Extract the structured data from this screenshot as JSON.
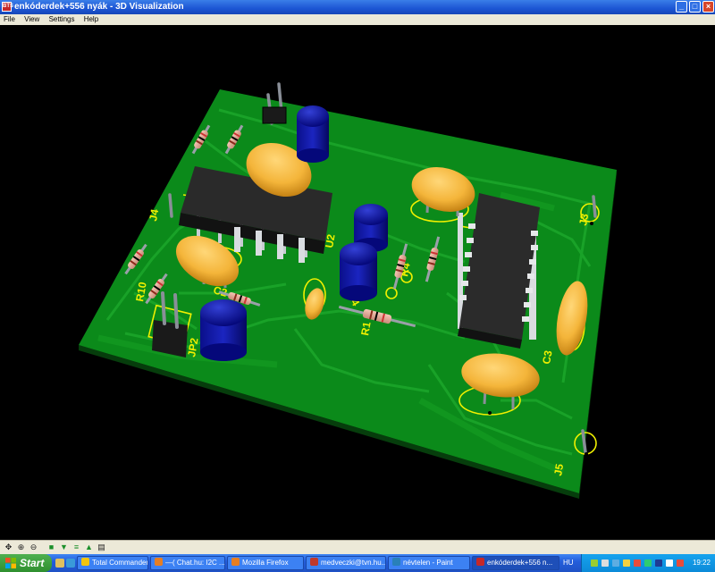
{
  "window": {
    "app_icon_text": "BTS",
    "title": "enkóderdek+556 nyák - 3D Visualization",
    "controls": {
      "minimize": "_",
      "maximize": "□",
      "close": "×"
    }
  },
  "menu": [
    "File",
    "View",
    "Settings",
    "Help"
  ],
  "viewer": {
    "background": "#000000",
    "board_color": "#0b8a1a",
    "silkscreen_color": "#f0f000",
    "labels": [
      "J3",
      "J5",
      "C2",
      "C3",
      "C4",
      "U2",
      "U3",
      "R1",
      "R4",
      "R10",
      "JP2",
      "J4"
    ],
    "components": [
      "two 14-pin DIP ICs",
      "blue electrolytic capacitors",
      "yellow ceramic capacitors",
      "resistors",
      "jumper header"
    ]
  },
  "toolstrip": {
    "icons": [
      "pan-icon",
      "zoom-in-icon",
      "zoom-out-icon",
      "board-color-icon",
      "top-view-icon",
      "layer-icon",
      "component-icon",
      "settings-icon"
    ]
  },
  "taskbar": {
    "start_label": "Start",
    "tasks": [
      {
        "label": "Total Commander ...",
        "icon_color": "#f1c40f",
        "active": false
      },
      {
        "label": "—( Chat.hu: I2C ...",
        "icon_color": "#e67e22",
        "active": false
      },
      {
        "label": "Mozilla Firefox",
        "icon_color": "#e67e22",
        "active": false
      },
      {
        "label": "medveczki@tvn.hu...",
        "icon_color": "#c0392b",
        "active": false
      },
      {
        "label": "névtelen - Paint",
        "icon_color": "#2980b9",
        "active": false
      },
      {
        "label": "enkóderdek+556 n...",
        "icon_color": "#c62828",
        "active": true
      }
    ],
    "language": "HU",
    "clock": "19:22"
  }
}
